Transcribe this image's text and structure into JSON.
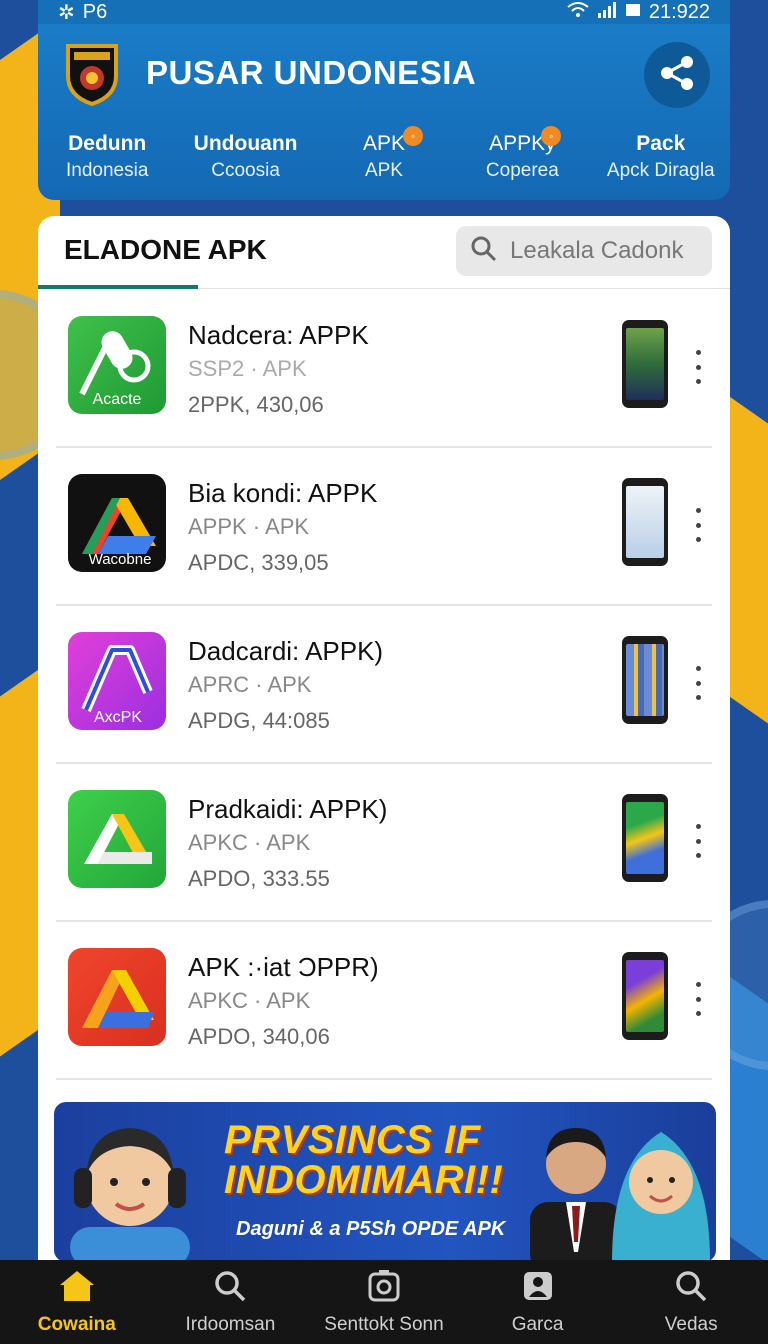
{
  "status_bar": {
    "left_text": "P6",
    "time": "21:922"
  },
  "header": {
    "app_title": "PUSAR UNDONESIA",
    "tabs": [
      {
        "line1": "Dedunn",
        "line2": "Indonesia",
        "badge": false
      },
      {
        "line1": "Undouann",
        "line2": "Ccoosia",
        "badge": false
      },
      {
        "line1": "APK",
        "line2": "APK",
        "badge": true
      },
      {
        "line1": "APPKy",
        "line2": "Coperea",
        "badge": true
      },
      {
        "line1": "Pack",
        "line2": "Apck Diragla",
        "badge": false
      }
    ]
  },
  "main": {
    "section_title": "ELADONE APK",
    "search_placeholder": "Leakala Cadonk",
    "apps": [
      {
        "name": "Nadcera: APPK",
        "sub": "SSP2 · APK",
        "meta": "2PPK,  430,06",
        "icon_label": "Acacte"
      },
      {
        "name": "Bia kondi: APPK",
        "sub": "APPK · APK",
        "meta": "APDC,  339,05",
        "icon_label": "Wacobne"
      },
      {
        "name": "Dadcardi: APPK)",
        "sub": "APRC · APK",
        "meta": "APDG,  44:085",
        "icon_label": "AxcPK"
      },
      {
        "name": "Pradkaidi: APPK)",
        "sub": "APKC · APK",
        "meta": "APDO,  333.55",
        "icon_label": ""
      },
      {
        "name": "APK :·iat ƆPPR)",
        "sub": "APKC · APK",
        "meta": "APDO,  340,06",
        "icon_label": ""
      }
    ]
  },
  "banner": {
    "headline_1": "PRVSINCS IF",
    "headline_2": "INDOMIMARI!!",
    "tagline": "Daguni & a P5Sh OPDE APK"
  },
  "bottom_nav": [
    {
      "label": "Cowaina",
      "icon": "home-icon",
      "active": true
    },
    {
      "label": "Irdoomsan",
      "icon": "search-icon",
      "active": false
    },
    {
      "label": "Senttokt Sonn",
      "icon": "camera-icon",
      "active": false
    },
    {
      "label": "Garca",
      "icon": "image-icon",
      "active": false
    },
    {
      "label": "Vedas",
      "icon": "search-icon",
      "active": false
    }
  ],
  "colors": {
    "header_blue": "#1a7cc7",
    "accent_yellow": "#f5c518",
    "tab_underline": "#137a6a"
  }
}
